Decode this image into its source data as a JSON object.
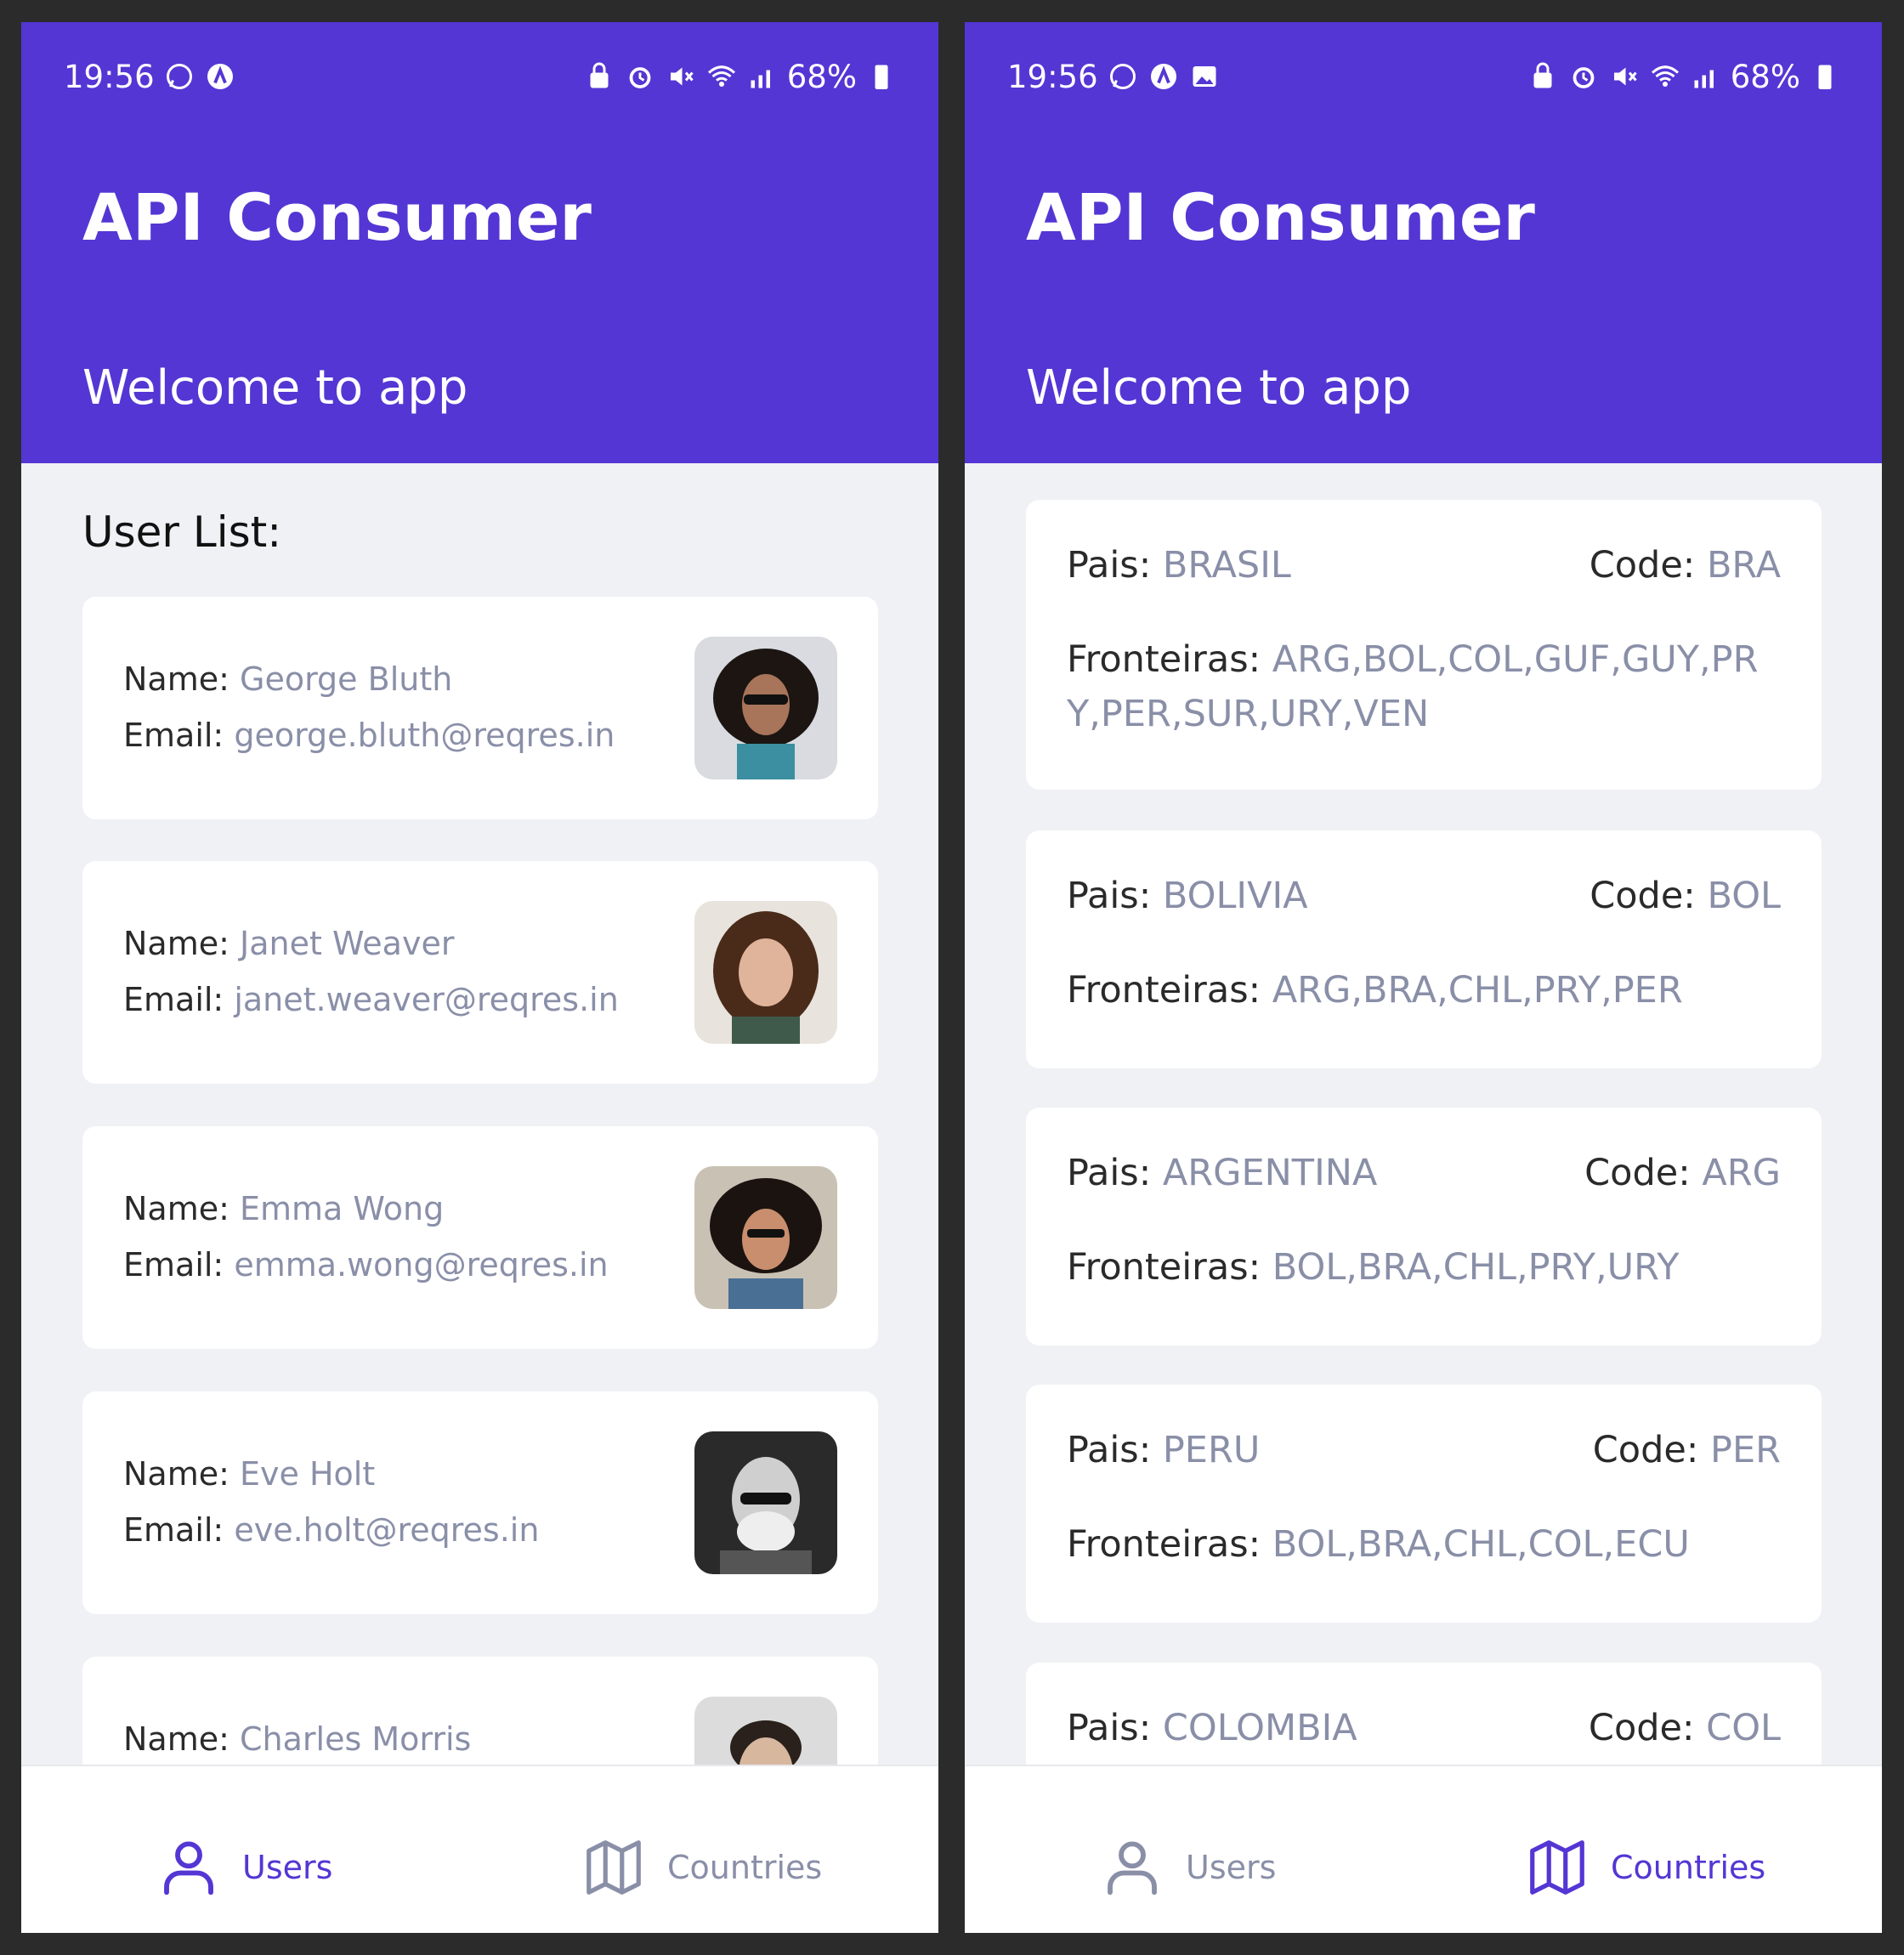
{
  "app": {
    "title": "API Consumer",
    "subtitle": "Welcome to app"
  },
  "status_bar": {
    "time": "19:56",
    "battery": "68%"
  },
  "labels": {
    "name": "Name:",
    "email": "Email:",
    "pais": "Pais:",
    "code": "Code:",
    "fronteiras": "Fronteiras:"
  },
  "users_screen": {
    "section_title": "User List:",
    "users": [
      {
        "name": "George Bluth",
        "email": "george.bluth@reqres.in"
      },
      {
        "name": "Janet Weaver",
        "email": "janet.weaver@reqres.in"
      },
      {
        "name": "Emma Wong",
        "email": "emma.wong@reqres.in"
      },
      {
        "name": "Eve Holt",
        "email": "eve.holt@reqres.in"
      },
      {
        "name": "Charles Morris",
        "email": ""
      }
    ]
  },
  "countries_screen": {
    "countries": [
      {
        "pais": "BRASIL",
        "code": "BRA",
        "fronteiras": "ARG,BOL,COL,GUF,GUY,PRY,PER,SUR,URY,VEN"
      },
      {
        "pais": "BOLIVIA",
        "code": "BOL",
        "fronteiras": "ARG,BRA,CHL,PRY,PER"
      },
      {
        "pais": "ARGENTINA",
        "code": "ARG",
        "fronteiras": "BOL,BRA,CHL,PRY,URY"
      },
      {
        "pais": "PERU",
        "code": "PER",
        "fronteiras": "BOL,BRA,CHL,COL,ECU"
      },
      {
        "pais": "COLOMBIA",
        "code": "COL",
        "fronteiras": ""
      }
    ]
  },
  "nav": {
    "users": "Users",
    "countries": "Countries"
  },
  "colors": {
    "primary": "#5436d4",
    "background": "#f0f1f5",
    "value_text": "#8a8fa8"
  }
}
